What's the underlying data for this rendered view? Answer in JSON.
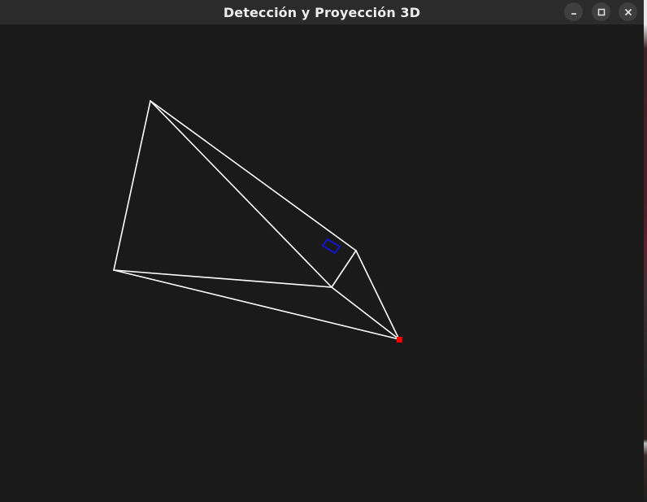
{
  "window": {
    "title": "Detección y Proyección 3D",
    "buttons": {
      "minimize_icon": "minimize-icon",
      "maximize_icon": "maximize-icon",
      "close_icon": "close-icon"
    }
  },
  "scene": {
    "background_color": "#1a1a1a",
    "wireframe_color": "#ffffff",
    "detection_box_color": "#1414c8",
    "projection_point_color": "#ff0000"
  }
}
